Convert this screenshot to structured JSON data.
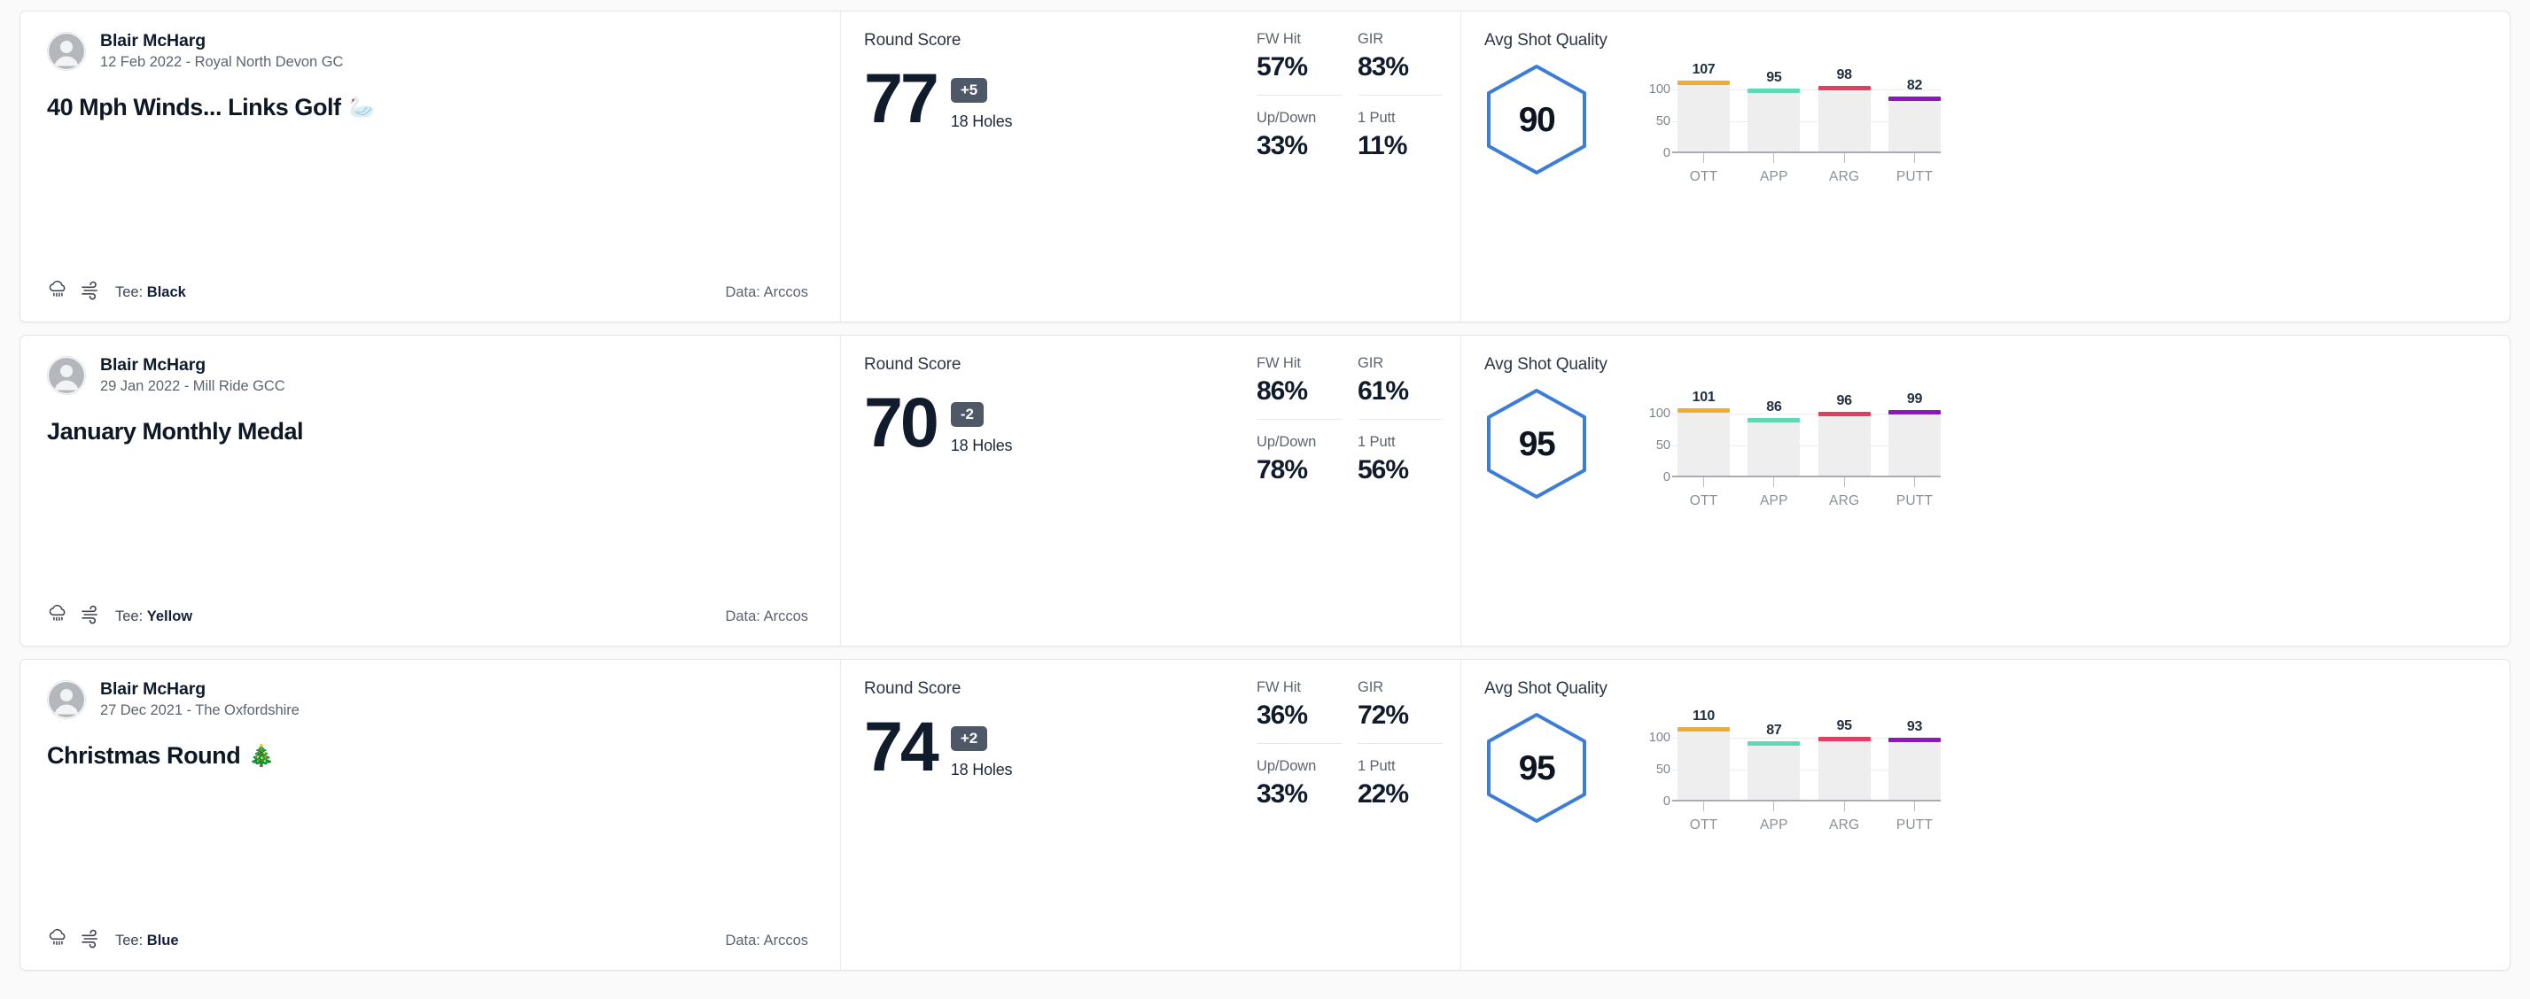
{
  "theme": {
    "card_bg": "#ffffff",
    "page_bg": "#fafafa",
    "hex_stroke": "#3b7dd8",
    "to_par_bg": "#4e5866",
    "bar_track": "#eeeeee",
    "cap_colors": [
      "#f0ad2b",
      "#5fd9b5",
      "#e13e62",
      "#9013c4"
    ]
  },
  "labels": {
    "round_score": "Round Score",
    "holes": "18 Holes",
    "avg_shot_quality": "Avg Shot Quality",
    "fw_hit": "FW Hit",
    "gir": "GIR",
    "up_down": "Up/Down",
    "one_putt": "1 Putt",
    "tee_prefix": "Tee:",
    "data_prefix": "Data:"
  },
  "rounds": [
    {
      "player": "Blair McHarg",
      "meta": "12 Feb 2022 - Royal North Devon GC",
      "title": "40 Mph Winds... Links Golf",
      "title_emoji": "🦢",
      "tee": "Black",
      "data_source": "Arccos",
      "score": "77",
      "to_par": "+5",
      "holes": "18 Holes",
      "fw_hit": "57%",
      "gir": "83%",
      "up_down": "33%",
      "one_putt": "11%",
      "avg_quality": "90",
      "chart_data": {
        "type": "bar",
        "title": "Avg Shot Quality",
        "categories": [
          "OTT",
          "APP",
          "ARG",
          "PUTT"
        ],
        "values": [
          107,
          95,
          98,
          82
        ],
        "colors": [
          "#f0ad2b",
          "#5fd9b5",
          "#e13e62",
          "#9013c4"
        ],
        "ylim": [
          0,
          125
        ],
        "yticks": [
          0,
          50,
          100
        ],
        "ylabel": "",
        "xlabel": "",
        "grid": true,
        "legend": "none"
      }
    },
    {
      "player": "Blair McHarg",
      "meta": "29 Jan 2022 - Mill Ride GCC",
      "title": "January Monthly Medal",
      "title_emoji": "",
      "tee": "Yellow",
      "data_source": "Arccos",
      "score": "70",
      "to_par": "-2",
      "holes": "18 Holes",
      "fw_hit": "86%",
      "gir": "61%",
      "up_down": "78%",
      "one_putt": "56%",
      "avg_quality": "95",
      "chart_data": {
        "type": "bar",
        "title": "Avg Shot Quality",
        "categories": [
          "OTT",
          "APP",
          "ARG",
          "PUTT"
        ],
        "values": [
          101,
          86,
          96,
          99
        ],
        "colors": [
          "#f0ad2b",
          "#5fd9b5",
          "#e13e62",
          "#9013c4"
        ],
        "ylim": [
          0,
          125
        ],
        "yticks": [
          0,
          50,
          100
        ],
        "ylabel": "",
        "xlabel": "",
        "grid": true,
        "legend": "none"
      }
    },
    {
      "player": "Blair McHarg",
      "meta": "27 Dec 2021 - The Oxfordshire",
      "title": "Christmas Round",
      "title_emoji": "🎄",
      "tee": "Blue",
      "data_source": "Arccos",
      "score": "74",
      "to_par": "+2",
      "holes": "18 Holes",
      "fw_hit": "36%",
      "gir": "72%",
      "up_down": "33%",
      "one_putt": "22%",
      "avg_quality": "95",
      "chart_data": {
        "type": "bar",
        "title": "Avg Shot Quality",
        "categories": [
          "OTT",
          "APP",
          "ARG",
          "PUTT"
        ],
        "values": [
          110,
          87,
          95,
          93
        ],
        "colors": [
          "#f0ad2b",
          "#5fd9b5",
          "#e13e62",
          "#9013c4"
        ],
        "ylim": [
          0,
          125
        ],
        "yticks": [
          0,
          50,
          100
        ],
        "ylabel": "",
        "xlabel": "",
        "grid": true,
        "legend": "none"
      }
    }
  ]
}
